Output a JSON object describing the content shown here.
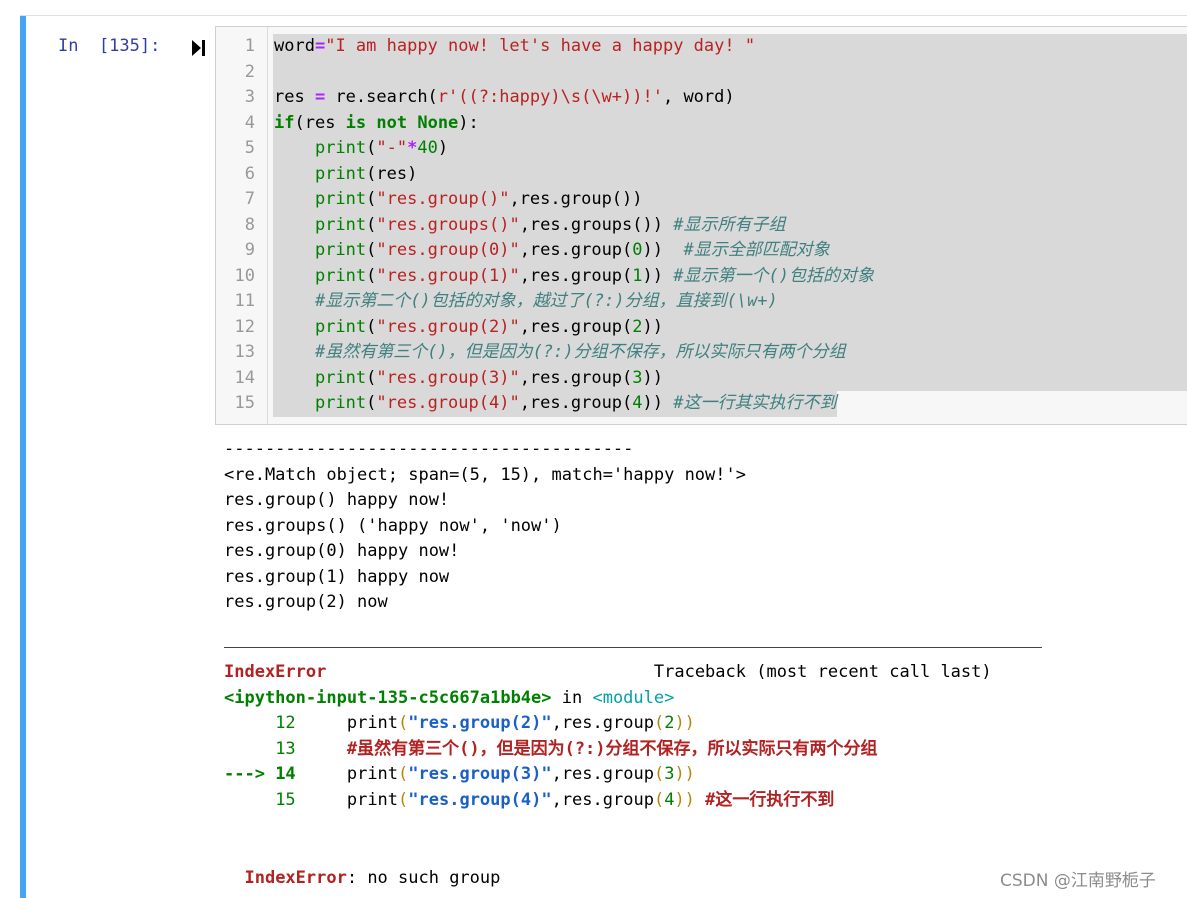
{
  "cell": {
    "prompt": "In  [135]:",
    "code_lines": [
      {
        "no": "1",
        "segs": [
          {
            "t": "word",
            "c": ""
          },
          {
            "t": "=",
            "c": "op"
          },
          {
            "t": "\"I am happy now! let's have a happy day! \"",
            "c": "str"
          }
        ]
      },
      {
        "no": "2",
        "segs": []
      },
      {
        "no": "3",
        "segs": [
          {
            "t": "res ",
            "c": ""
          },
          {
            "t": "=",
            "c": "op"
          },
          {
            "t": " re.search(",
            "c": ""
          },
          {
            "t": "r'((?:happy)\\s(\\w+))!'",
            "c": "str"
          },
          {
            "t": ", word)",
            "c": ""
          }
        ]
      },
      {
        "no": "4",
        "segs": [
          {
            "t": "if",
            "c": "kw"
          },
          {
            "t": "(res ",
            "c": ""
          },
          {
            "t": "is not",
            "c": "kw"
          },
          {
            "t": " ",
            "c": ""
          },
          {
            "t": "None",
            "c": "kw"
          },
          {
            "t": "):",
            "c": ""
          }
        ]
      },
      {
        "no": "5",
        "segs": [
          {
            "t": "    ",
            "c": ""
          },
          {
            "t": "print",
            "c": "bi"
          },
          {
            "t": "(",
            "c": ""
          },
          {
            "t": "\"-\"",
            "c": "str"
          },
          {
            "t": "*",
            "c": "op"
          },
          {
            "t": "40",
            "c": "num"
          },
          {
            "t": ")",
            "c": ""
          }
        ]
      },
      {
        "no": "6",
        "segs": [
          {
            "t": "    ",
            "c": ""
          },
          {
            "t": "print",
            "c": "bi"
          },
          {
            "t": "(res)",
            "c": ""
          }
        ]
      },
      {
        "no": "7",
        "segs": [
          {
            "t": "    ",
            "c": ""
          },
          {
            "t": "print",
            "c": "bi"
          },
          {
            "t": "(",
            "c": ""
          },
          {
            "t": "\"res.group()\"",
            "c": "str"
          },
          {
            "t": ",res.group())",
            "c": ""
          }
        ]
      },
      {
        "no": "8",
        "segs": [
          {
            "t": "    ",
            "c": ""
          },
          {
            "t": "print",
            "c": "bi"
          },
          {
            "t": "(",
            "c": ""
          },
          {
            "t": "\"res.groups()\"",
            "c": "str"
          },
          {
            "t": ",res.groups()) ",
            "c": ""
          },
          {
            "t": "#显示所有子组",
            "c": "cm"
          }
        ]
      },
      {
        "no": "9",
        "segs": [
          {
            "t": "    ",
            "c": ""
          },
          {
            "t": "print",
            "c": "bi"
          },
          {
            "t": "(",
            "c": ""
          },
          {
            "t": "\"res.group(0)\"",
            "c": "str"
          },
          {
            "t": ",res.group(",
            "c": ""
          },
          {
            "t": "0",
            "c": "num"
          },
          {
            "t": "))  ",
            "c": ""
          },
          {
            "t": "#显示全部匹配对象",
            "c": "cm"
          }
        ]
      },
      {
        "no": "10",
        "segs": [
          {
            "t": "    ",
            "c": ""
          },
          {
            "t": "print",
            "c": "bi"
          },
          {
            "t": "(",
            "c": ""
          },
          {
            "t": "\"res.group(1)\"",
            "c": "str"
          },
          {
            "t": ",res.group(",
            "c": ""
          },
          {
            "t": "1",
            "c": "num"
          },
          {
            "t": ")) ",
            "c": ""
          },
          {
            "t": "#显示第一个()包括的对象",
            "c": "cm"
          }
        ]
      },
      {
        "no": "11",
        "segs": [
          {
            "t": "    ",
            "c": ""
          },
          {
            "t": "#显示第二个()包括的对象，越过了(?:)分组，直接到(\\w+)",
            "c": "cm"
          }
        ]
      },
      {
        "no": "12",
        "segs": [
          {
            "t": "    ",
            "c": ""
          },
          {
            "t": "print",
            "c": "bi"
          },
          {
            "t": "(",
            "c": ""
          },
          {
            "t": "\"res.group(2)\"",
            "c": "str"
          },
          {
            "t": ",res.group(",
            "c": ""
          },
          {
            "t": "2",
            "c": "num"
          },
          {
            "t": "))",
            "c": ""
          }
        ]
      },
      {
        "no": "13",
        "segs": [
          {
            "t": "    ",
            "c": ""
          },
          {
            "t": "#虽然有第三个()，但是因为(?:)分组不保存，所以实际只有两个分组",
            "c": "cm"
          }
        ]
      },
      {
        "no": "14",
        "segs": [
          {
            "t": "    ",
            "c": ""
          },
          {
            "t": "print",
            "c": "bi"
          },
          {
            "t": "(",
            "c": ""
          },
          {
            "t": "\"res.group(3)\"",
            "c": "str"
          },
          {
            "t": ",res.group(",
            "c": ""
          },
          {
            "t": "3",
            "c": "num"
          },
          {
            "t": "))",
            "c": ""
          }
        ]
      },
      {
        "no": "15",
        "segs": [
          {
            "t": "    ",
            "c": ""
          },
          {
            "t": "print",
            "c": "bi"
          },
          {
            "t": "(",
            "c": ""
          },
          {
            "t": "\"res.group(4)\"",
            "c": "str"
          },
          {
            "t": ",res.group(",
            "c": ""
          },
          {
            "t": "4",
            "c": "num"
          },
          {
            "t": ")) ",
            "c": ""
          },
          {
            "t": "#这一行其实执行不到",
            "c": "cm"
          }
        ]
      }
    ]
  },
  "output": {
    "stdout_lines": [
      "----------------------------------------",
      "<re.Match object; span=(5, 15), match='happy now!'>",
      "res.group() happy now!",
      "res.groups() ('happy now', 'now')",
      "res.group(0) happy now!",
      "res.group(1) happy now",
      "res.group(2) now"
    ],
    "traceback": [
      {
        "segs": [
          {
            "t": "IndexError",
            "c": "err-red"
          },
          {
            "t": "                                Traceback (most recent call last)",
            "c": ""
          }
        ]
      },
      {
        "segs": [
          {
            "t": "<ipython-input-135-c5c667a1bb4e>",
            "c": "err-green"
          },
          {
            "t": " in ",
            "c": ""
          },
          {
            "t": "<module>",
            "c": "err-cyan"
          }
        ]
      },
      {
        "segs": [
          {
            "t": "     ",
            "c": ""
          },
          {
            "t": "12",
            "c": "err-green-plain"
          },
          {
            "t": "     print",
            "c": ""
          },
          {
            "t": "(",
            "c": "err-yellow"
          },
          {
            "t": "\"res.group(2)\"",
            "c": "err-blue"
          },
          {
            "t": ",res.group",
            "c": ""
          },
          {
            "t": "(",
            "c": "err-yellow"
          },
          {
            "t": "2",
            "c": "err-green-plain"
          },
          {
            "t": "))",
            "c": "err-yellow"
          }
        ]
      },
      {
        "segs": [
          {
            "t": "     ",
            "c": ""
          },
          {
            "t": "13",
            "c": "err-green-plain"
          },
          {
            "t": "     ",
            "c": ""
          },
          {
            "t": "#虽然有第三个()，但是因为(?:)分组不保存，所以实际只有两个分组",
            "c": "err-red"
          }
        ]
      },
      {
        "segs": [
          {
            "t": "---> ",
            "c": "err-green"
          },
          {
            "t": "14",
            "c": "err-green"
          },
          {
            "t": "     print",
            "c": ""
          },
          {
            "t": "(",
            "c": "err-yellow"
          },
          {
            "t": "\"res.group(3)\"",
            "c": "err-blue"
          },
          {
            "t": ",res.group",
            "c": ""
          },
          {
            "t": "(",
            "c": "err-yellow"
          },
          {
            "t": "3",
            "c": "err-green-plain"
          },
          {
            "t": "))",
            "c": "err-yellow"
          }
        ]
      },
      {
        "segs": [
          {
            "t": "     ",
            "c": ""
          },
          {
            "t": "15",
            "c": "err-green-plain"
          },
          {
            "t": "     print",
            "c": ""
          },
          {
            "t": "(",
            "c": "err-yellow"
          },
          {
            "t": "\"res.group(4)\"",
            "c": "err-blue"
          },
          {
            "t": ",res.group",
            "c": ""
          },
          {
            "t": "(",
            "c": "err-yellow"
          },
          {
            "t": "4",
            "c": "err-green-plain"
          },
          {
            "t": ")) ",
            "c": "err-yellow"
          },
          {
            "t": "#这一行执行不到",
            "c": "err-red"
          }
        ]
      }
    ],
    "error_name": "IndexError",
    "error_msg": ": no such group"
  },
  "watermark": "CSDN @江南野栀子",
  "colors": {
    "cell_bar": "#42a5f5",
    "prompt": "#303f9f",
    "string": "#ba2121",
    "keyword": "#008000",
    "comment": "#408080"
  }
}
